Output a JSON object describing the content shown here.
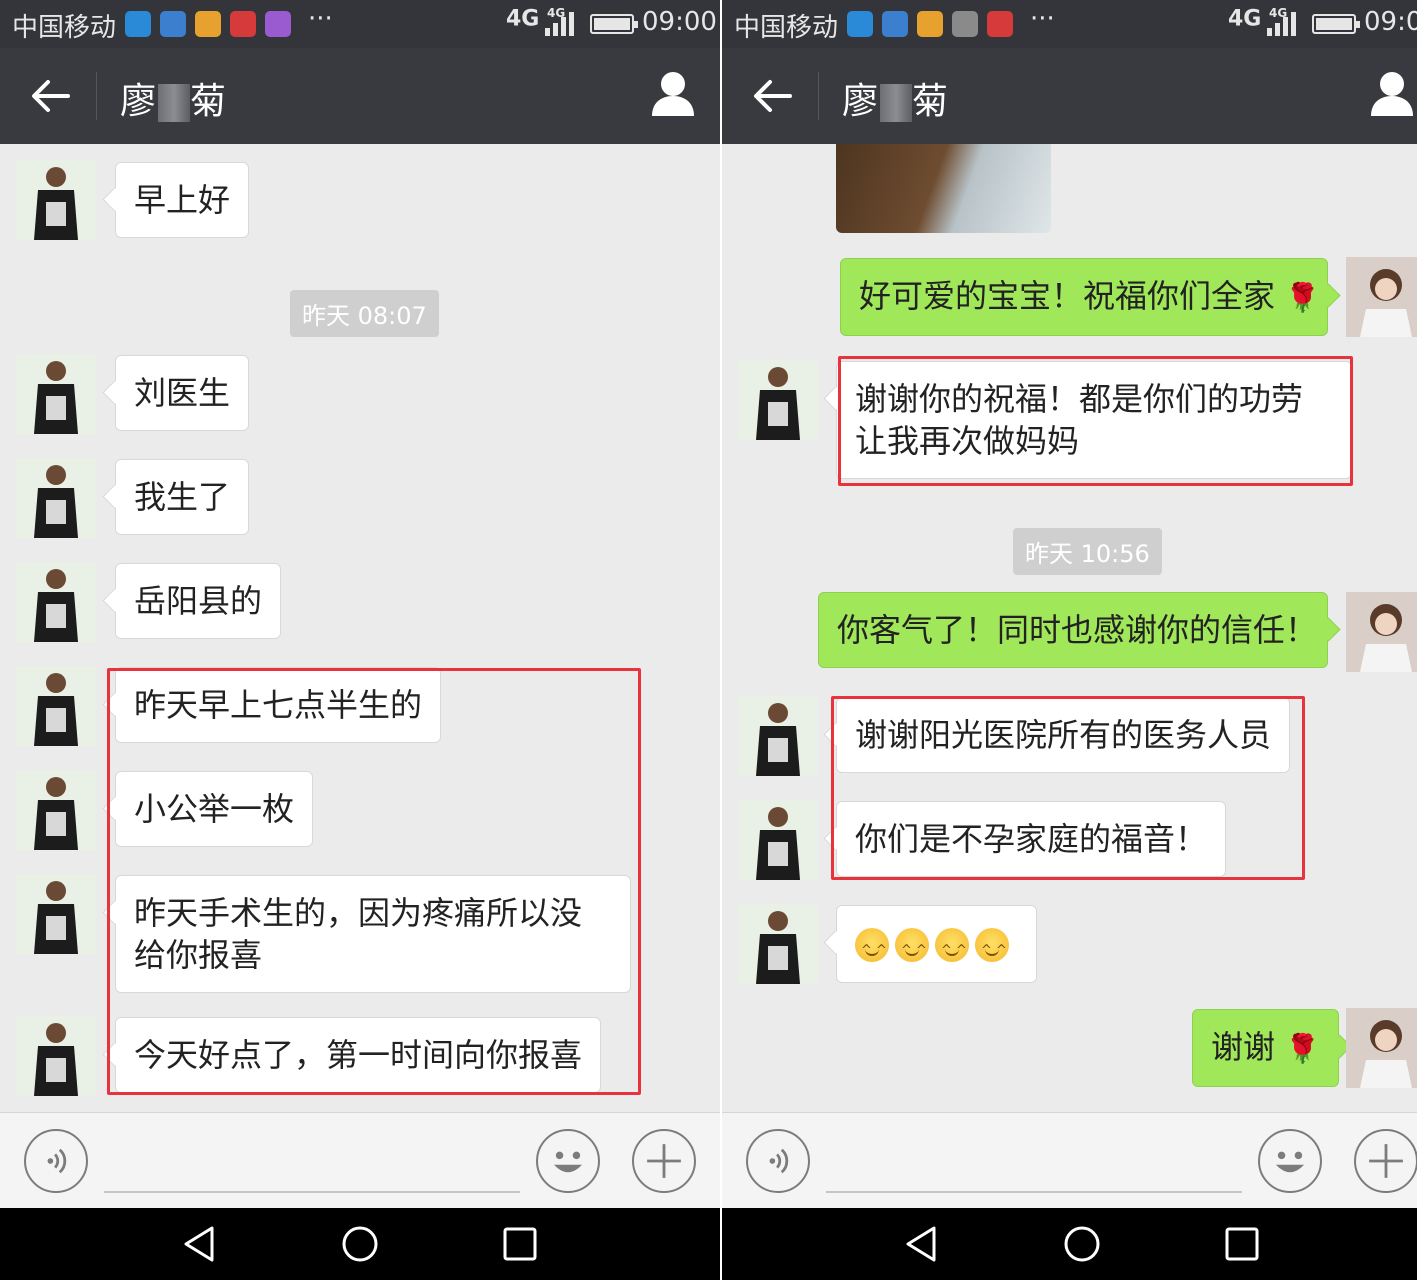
{
  "status_bar": {
    "carrier": "中国移动",
    "network": "4G",
    "network_small": "4G",
    "time_left": "09:00",
    "time_right": "09:0",
    "more_indicator": "···",
    "notification_icons": [
      "app-icon-blue",
      "health-icon",
      "app-icon-orange",
      "huawei-icon",
      "keyboard-icon"
    ]
  },
  "title_bar": {
    "title_first": "廖",
    "title_last": "菊",
    "back_icon": "back-arrow-icon",
    "profile_icon": "person-icon"
  },
  "left_panel": {
    "messages": [
      {
        "side": "in",
        "text": "早上好"
      },
      {
        "type": "time",
        "text": "昨天 08:07"
      },
      {
        "side": "in",
        "text": "刘医生"
      },
      {
        "side": "in",
        "text": "我生了"
      },
      {
        "side": "in",
        "text": "岳阳县的"
      },
      {
        "side": "in",
        "text": "昨天早上七点半生的"
      },
      {
        "side": "in",
        "text": "小公举一枚"
      },
      {
        "side": "in",
        "text": "昨天手术生的，因为疼痛所以没给你报喜"
      },
      {
        "side": "in",
        "text": "今天好点了，第一时间向你报喜"
      }
    ]
  },
  "right_panel": {
    "messages": [
      {
        "type": "image",
        "text": ""
      },
      {
        "side": "out",
        "text": "好可爱的宝宝！祝福你们全家",
        "emoji": "🌹"
      },
      {
        "side": "in",
        "text": "谢谢你的祝福！都是你们的功劳让我再次做妈妈"
      },
      {
        "type": "time",
        "text": "昨天 10:56"
      },
      {
        "side": "out",
        "text": "你客气了！同时也感谢你的信任！"
      },
      {
        "side": "in",
        "text": "谢谢阳光医院所有的医务人员"
      },
      {
        "side": "in",
        "text": "你们是不孕家庭的福音！"
      },
      {
        "side": "in",
        "emoji": "smiley-emoji x4"
      },
      {
        "side": "out",
        "text": "谢谢",
        "emoji": "🌹"
      }
    ]
  },
  "input_bar": {
    "voice_icon": "voice-icon",
    "emoji_icon": "emoji-icon",
    "plus_icon": "plus-icon"
  },
  "nav_bar": {
    "back": "nav-back-icon",
    "home": "nav-home-icon",
    "recents": "nav-recents-icon"
  },
  "colors": {
    "status_bar": "#33353a",
    "title_bar": "#393a3f",
    "chat_bg": "#ebebeb",
    "bubble_out": "#a0e75a",
    "bubble_in": "#ffffff",
    "highlight": "#e8323c"
  }
}
